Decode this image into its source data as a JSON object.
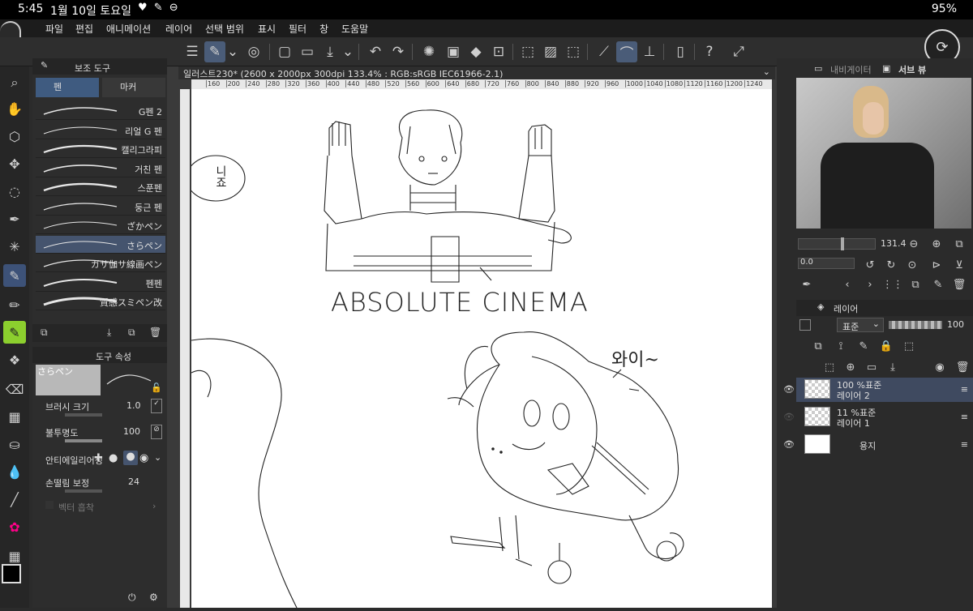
{
  "status": {
    "time": "5:45",
    "date": "1월 10일 토요일",
    "icons": "♥ ✎ ⊖",
    "right": "95%"
  },
  "menu": [
    "파일",
    "편집",
    "애니메이션",
    "레이어",
    "선택 범위",
    "표시",
    "필터",
    "창",
    "도움말"
  ],
  "subtool": {
    "header": "보조 도구",
    "tabs": [
      "펜",
      "마커"
    ],
    "brushes": [
      "G펜 2",
      "리얼 G 펜",
      "캘리그라피",
      "거친 펜",
      "스푼펜",
      "둥근 펜",
      "ざかペン",
      "さらペン",
      "ガサ伽サ線画ペン",
      "펜펜",
      "質感スミペン改"
    ]
  },
  "props": {
    "header": "도구 속성",
    "brush_name": "さらペン",
    "size_label": "브러시 크기",
    "size_value": "1.0",
    "opacity_label": "불투명도",
    "opacity_value": "100",
    "aa_label": "안티에일리어싱",
    "stab_label": "손떨림 보정",
    "stab_value": "24",
    "vector_label": "벡터 흡착"
  },
  "doc": {
    "title": "일러스트230* (2600 x 2000px 300dpi 133.4% : RGB:sRGB IEC61966-2.1)"
  },
  "ruler": {
    "marks": [
      "160",
      "200",
      "240",
      "280",
      "320",
      "360",
      "400",
      "440",
      "480",
      "520",
      "560",
      "600",
      "640",
      "680",
      "720",
      "760",
      "800",
      "840",
      "880",
      "920",
      "960",
      "1000",
      "1040",
      "1080",
      "1120",
      "1160",
      "1200",
      "1240"
    ]
  },
  "canvas": {
    "caption": "ABSOLUTE CINEMA",
    "speech": "와이~",
    "bubble": "니죠"
  },
  "navigator": {
    "tab1": "내비게이터",
    "tab2": "서브 뷰",
    "zoom": "131.4",
    "angle": "0.0"
  },
  "layers": {
    "header": "레이어",
    "blend": "표준",
    "opacity": "100",
    "items": [
      {
        "mode": "100 %표준",
        "name": "레이어 2"
      },
      {
        "mode": "11 %표준",
        "name": "레이어 1"
      },
      {
        "mode": "",
        "name": "용지"
      }
    ]
  }
}
